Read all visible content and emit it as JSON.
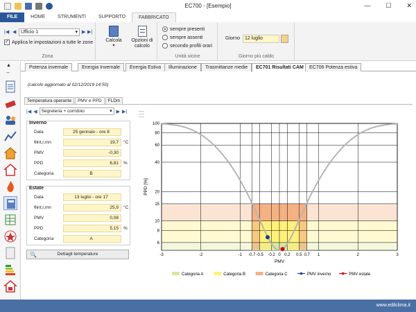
{
  "window": {
    "title": "EC700 - [Esempio]"
  },
  "ribbon_tabs": [
    {
      "label": "FILE"
    },
    {
      "label": "HOME"
    },
    {
      "label": "STRUMENTI"
    },
    {
      "label": "SUPPORTO"
    },
    {
      "label": "FABBRICATO"
    }
  ],
  "ribbon": {
    "zona": {
      "select_value": "Ufficio 1",
      "apply_all_label": "Applica le impostazioni a tutte le zone",
      "group_label": "Zona"
    },
    "calcola_label": "Calcola",
    "opzioni_label": "Opzioni di calcolo",
    "unita": {
      "options": [
        "sempre presenti",
        "sempre assenti",
        "secondo profili orari"
      ],
      "group_label": "Unità vicine"
    },
    "giorno": {
      "label": "Giorno",
      "value": "12 luglio",
      "group_label": "Giorno più caldo"
    }
  },
  "doc_tabs": [
    {
      "label": "Potenza invernale"
    },
    {
      "label": "Energia Invernale"
    },
    {
      "label": "Energia Estiva"
    },
    {
      "label": "Illuminazione"
    },
    {
      "label": "Trasmittanze medie"
    },
    {
      "label": "EC701 Risultati CAM"
    },
    {
      "label": "EC706 Potenza estiva"
    }
  ],
  "calc_note": "(calcolo aggiornato al 02/12/2019 14:50)",
  "sub_tabs": [
    {
      "label": "Temperatura operante"
    },
    {
      "label": "PMV e PPD"
    },
    {
      "label": "FLDm"
    }
  ],
  "zone_select": "Segreteria + corridoio",
  "inverno": {
    "title": "Inverno",
    "rows": [
      {
        "label": "Data",
        "value": "25 gennaio - ore 8",
        "unit": ""
      },
      {
        "label": "θint,r,mn",
        "value": "19,7",
        "unit": "°C"
      },
      {
        "label": "PMV",
        "value": "-0,30",
        "unit": ""
      },
      {
        "label": "PPD",
        "value": "6,81",
        "unit": "%"
      },
      {
        "label": "Categoria",
        "value": "B",
        "unit": ""
      }
    ]
  },
  "estate": {
    "title": "Estate",
    "rows": [
      {
        "label": "Data",
        "value": "13 luglio - ore 17",
        "unit": ""
      },
      {
        "label": "θint,r,mn",
        "value": "25,9",
        "unit": "°C"
      },
      {
        "label": "PMV",
        "value": "0,08",
        "unit": ""
      },
      {
        "label": "PPD",
        "value": "5,15",
        "unit": "%"
      },
      {
        "label": "Categoria",
        "value": "A",
        "unit": ""
      }
    ]
  },
  "details_button": "Dettagli temperature",
  "status": {
    "text": "www.edilclima.it"
  },
  "chart_data": {
    "type": "line",
    "xlabel": "PMV",
    "ylabel": "PPD [%]",
    "xlim": [
      -3,
      3
    ],
    "ylim": [
      5,
      100
    ],
    "yscale": "log",
    "x_ticks": [
      -3,
      -2,
      -1,
      -0.7,
      -0.5,
      -0.2,
      0,
      0.2,
      0.5,
      0.7,
      1,
      2,
      3
    ],
    "x_tick_labels": [
      "-3",
      "-2",
      "-1",
      "-0.7",
      "-0.5",
      "-0.2",
      "0",
      "0.2",
      "0.5",
      "0.7",
      "1",
      "2",
      "3"
    ],
    "y_ticks": [
      6,
      8,
      10,
      15,
      20,
      40,
      60,
      80,
      100
    ],
    "y_tick_labels": [
      "6",
      "8",
      "10",
      "15",
      "20",
      "40",
      "60",
      "80",
      "100"
    ],
    "bands": [
      {
        "name": "Categoria C",
        "pmv": [
          -0.7,
          0.7
        ],
        "ppd": [
          5,
          15
        ],
        "color": "#f4b183"
      },
      {
        "name": "Categoria B",
        "pmv": [
          -0.5,
          0.5
        ],
        "ppd": [
          5,
          10
        ],
        "color": "#fff27a"
      },
      {
        "name": "Categoria A",
        "pmv": [
          -0.2,
          0.2
        ],
        "ppd": [
          5,
          6
        ],
        "color": "#d9e8a0"
      }
    ],
    "series": [
      {
        "name": "PMV inverno",
        "x": [
          -0.3
        ],
        "y": [
          6.81
        ],
        "color": "#1f3a93"
      },
      {
        "name": "PMV estate",
        "x": [
          0.08
        ],
        "y": [
          5.15
        ],
        "color": "#d40000"
      }
    ],
    "legend": {
      "placement": "bottom",
      "items": [
        {
          "name": "Categoria A",
          "color": "#d9e8a0",
          "kind": "box"
        },
        {
          "name": "Categoria B",
          "color": "#fff27a",
          "kind": "box"
        },
        {
          "name": "Categoria C",
          "color": "#f4b183",
          "kind": "box"
        },
        {
          "name": "PMV inverno",
          "color": "#1f3a93",
          "kind": "line"
        },
        {
          "name": "PMV estate",
          "color": "#d40000",
          "kind": "line"
        }
      ]
    },
    "grid": true
  }
}
